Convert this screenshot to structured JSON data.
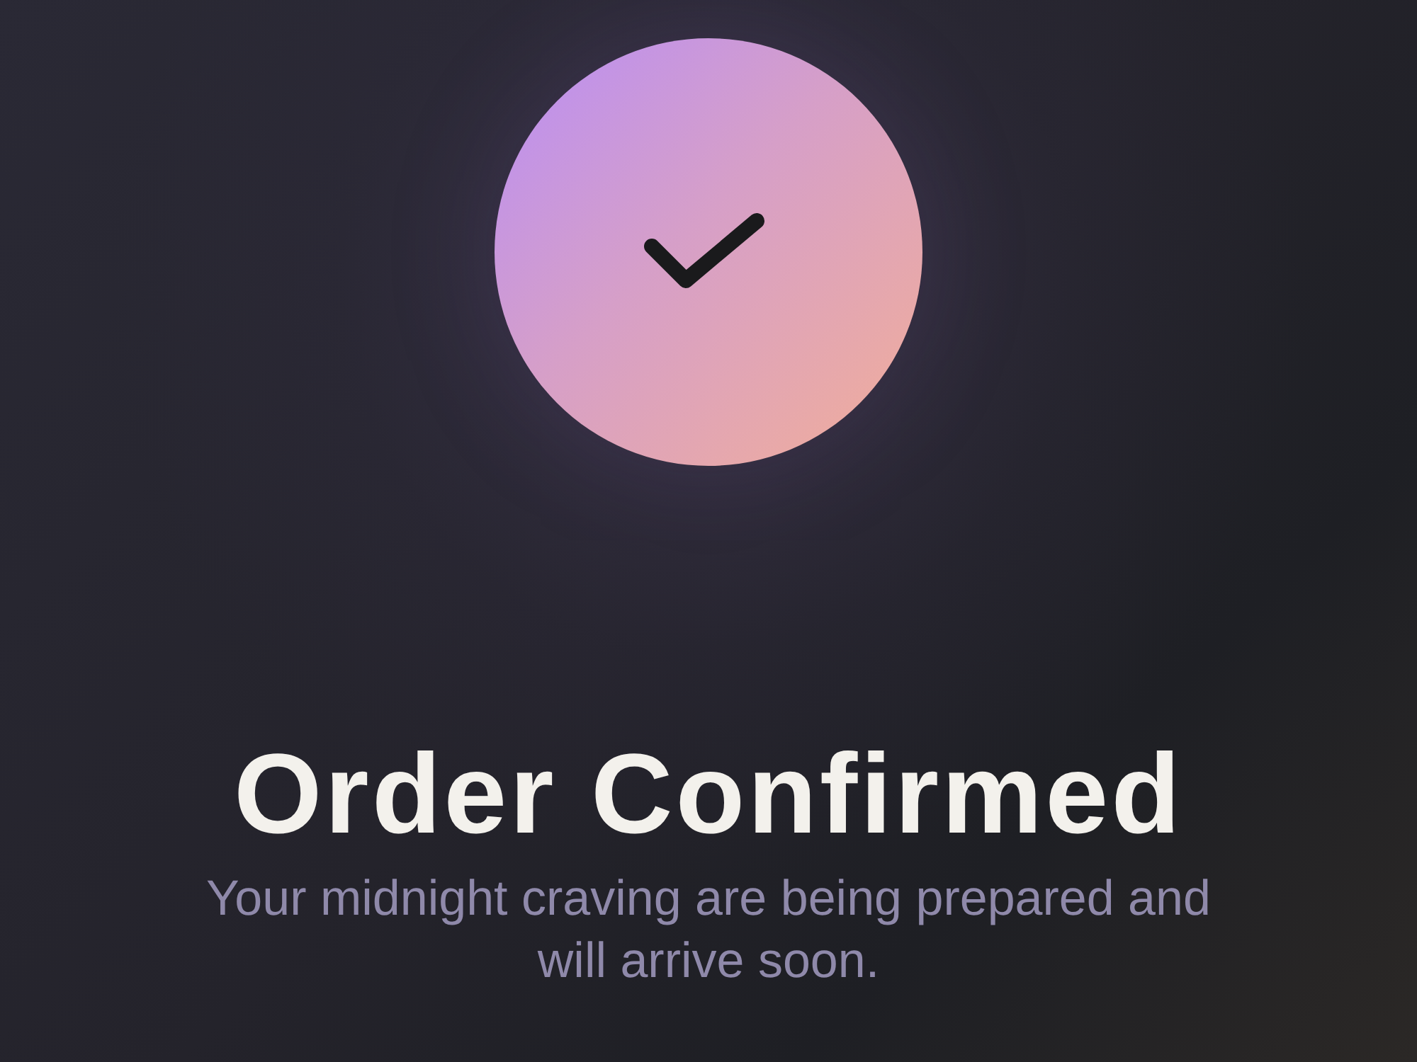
{
  "status_icon": {
    "kind": "success"
  },
  "title": "Order Confirmed",
  "message": "Your midnight craving are being prepared and will arrive soon."
}
